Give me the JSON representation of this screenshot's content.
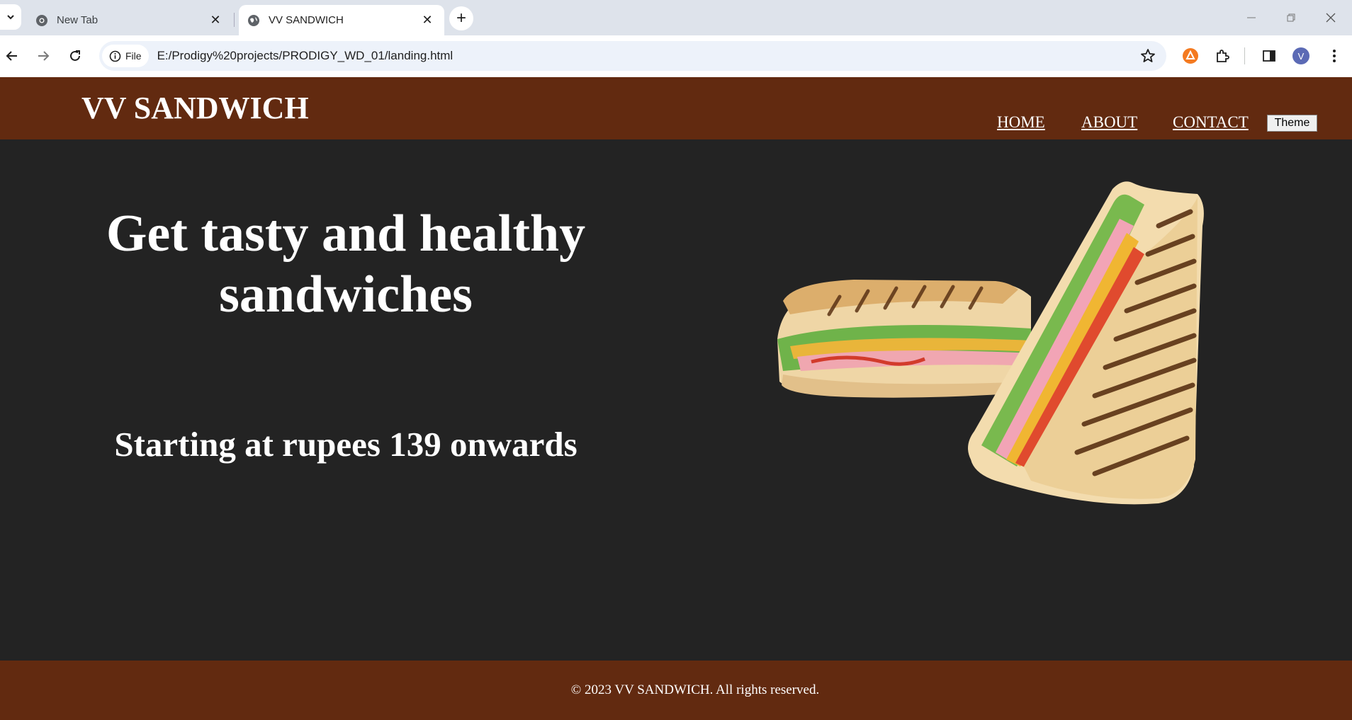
{
  "browser": {
    "tabs": [
      {
        "title": "New Tab"
      },
      {
        "title": "VV SANDWICH"
      }
    ],
    "site_chip_label": "File",
    "url": "E:/Prodigy%20projects/PRODIGY_WD_01/landing.html",
    "profile_initial": "V"
  },
  "site": {
    "brand": "VV SANDWICH",
    "nav": [
      "HOME",
      "ABOUT",
      "CONTACT"
    ],
    "theme_button": "Theme",
    "hero_title": "Get tasty and healthy sandwiches",
    "hero_subtitle": "Starting at rupees 139 onwards",
    "footer": "© 2023 VV SANDWICH. All rights reserved."
  },
  "colors": {
    "header_bg": "#622a10",
    "page_bg": "#232323",
    "text": "#ffffff"
  }
}
